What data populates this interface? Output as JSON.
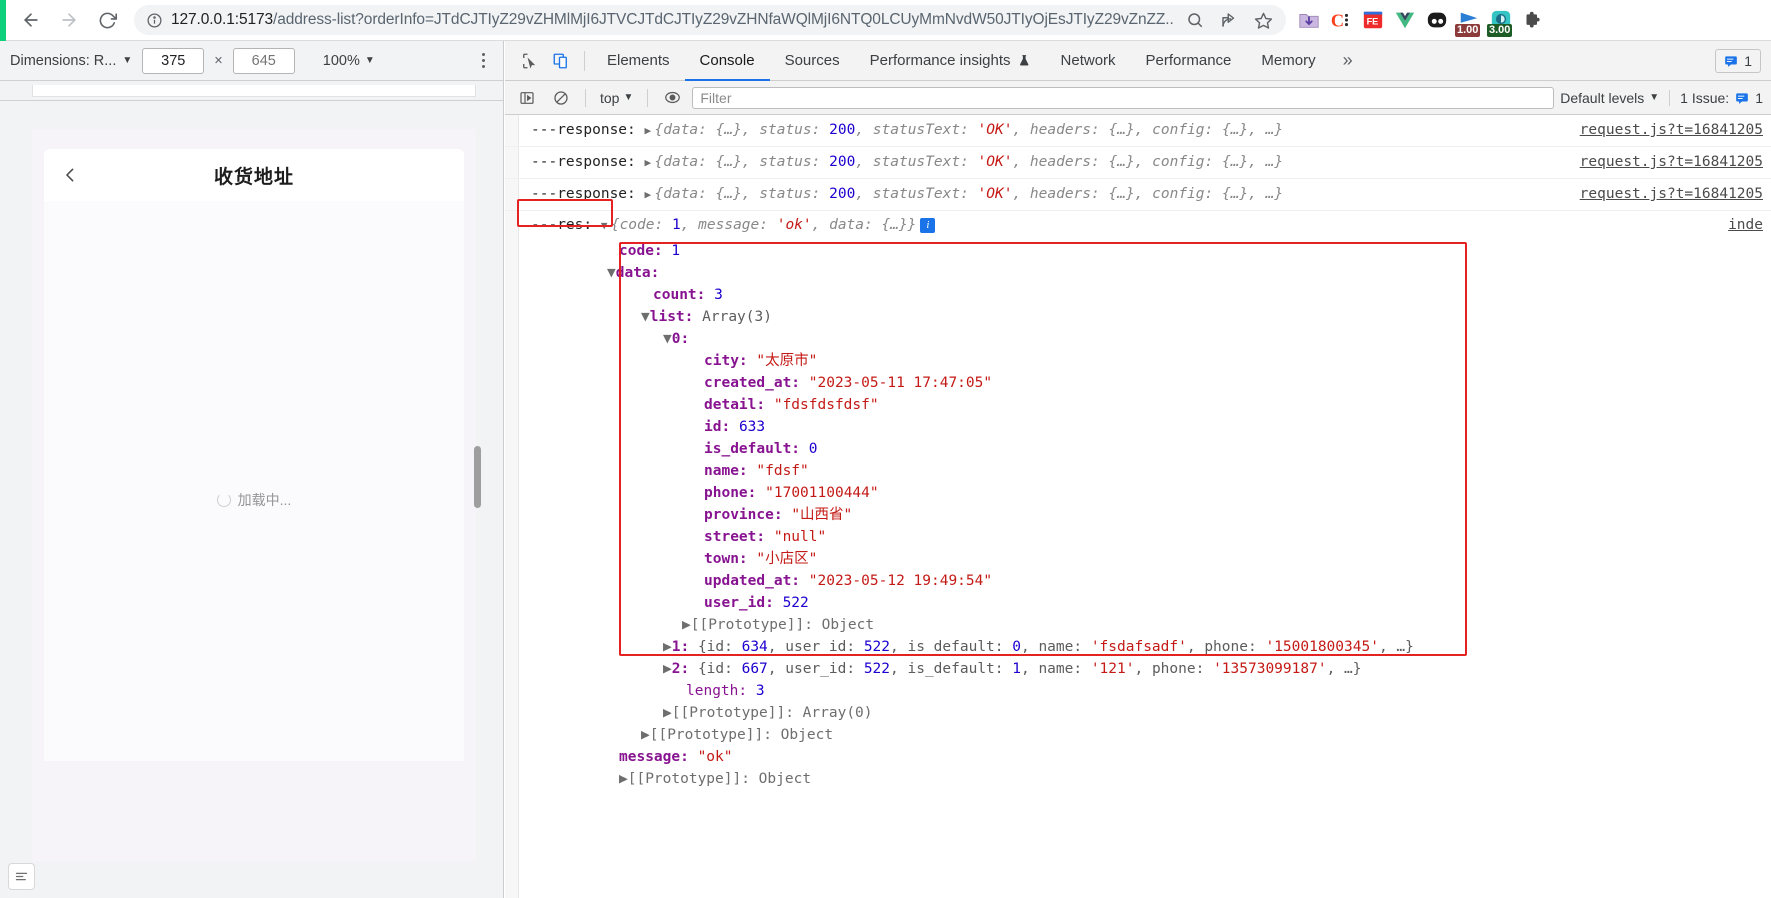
{
  "browser": {
    "back_icon": "arrow-left-icon",
    "forward_icon": "arrow-right-icon",
    "reload_icon": "reload-icon",
    "info_icon": "site-info-icon",
    "url_host": "127.0.0.1:5173",
    "url_path": "/address-list?orderInfo=",
    "url_query": "JTdCJTIyZ29vZHMlMjI6JTVCJTdCJTIyZ29vZHNfaWQlMjI6NTQ0LCUyMmNvdW50JTIyOjEsJTIyZ29vZnZZ...",
    "url_full": "127.0.0.1:5173/address-list?orderInfo=JTdCJTIyZ29vZHMlMjI6JTVCJTdCJTIyZ29vZHNfaWQlMjI6NTQ0LCUyMmNvdW50JTIyOjEsJTIyZ29vZvZ...",
    "zoom_icon": "zoom-out-icon",
    "share_icon": "share-icon",
    "bookmark_icon": "star-icon",
    "extensions": [
      {
        "name": "download-folder-extension-icon",
        "glyph": "folder",
        "badge": ""
      },
      {
        "name": "clickup-extension-icon",
        "glyph": "C",
        "badge": ""
      },
      {
        "name": "fe-helper-extension-icon",
        "glyph": "FE",
        "badge": ""
      },
      {
        "name": "vue-devtools-extension-icon",
        "glyph": "V",
        "badge": ""
      },
      {
        "name": "dark-reader-extension-icon",
        "glyph": "eyes",
        "badge": ""
      },
      {
        "name": "video-speed-controller-extension-icon",
        "glyph": "play",
        "badge": "1.00"
      },
      {
        "name": "video-speed-extension-icon",
        "glyph": "speed",
        "badge": "3.00"
      },
      {
        "name": "extensions-puzzle-icon",
        "glyph": "puzzle",
        "badge": ""
      }
    ]
  },
  "device_toolbar": {
    "dimensions_label": "Dimensions: R...",
    "dropdown_icon": "chevron-down-icon",
    "width_value": "375",
    "times": "×",
    "height_placeholder": "645",
    "zoom_value": "100%",
    "more_icon": "kebab-menu-icon"
  },
  "phone": {
    "back_icon": "chevron-left-icon",
    "title": "收货地址",
    "loading_text": "加载中...",
    "spinner_icon": "spinner-icon",
    "bottom_icon": "list-panel-icon"
  },
  "devtools": {
    "inspect_icon": "inspect-element-icon",
    "device_toggle_icon": "device-toolbar-icon",
    "tabs": [
      {
        "label": "Elements",
        "selected": false
      },
      {
        "label": "Console",
        "selected": true
      },
      {
        "label": "Sources",
        "selected": false
      },
      {
        "label": "Performance insights",
        "selected": false,
        "icon": "flask-icon"
      },
      {
        "label": "Network",
        "selected": false
      },
      {
        "label": "Performance",
        "selected": false
      },
      {
        "label": "Memory",
        "selected": false
      }
    ],
    "more_tabs_icon": "chevron-double-right-icon",
    "issue_count_label": "1",
    "issue_icon": "issue-message-icon",
    "filterbar": {
      "sidebar_toggle_icon": "console-sidebar-icon",
      "clear_icon": "clear-console-icon",
      "context_label": "top",
      "context_icon": "chevron-down-icon",
      "eye_icon": "live-expression-icon",
      "filter_placeholder": "Filter",
      "filter_value": "",
      "levels_label": "Default levels",
      "levels_icon": "chevron-down-icon",
      "issues_label": "1 Issue:",
      "issues_badge_icon": "issue-message-icon",
      "issues_count": "1"
    }
  },
  "console": {
    "response_rows": [
      {
        "label": "---response:",
        "arrow": "▶",
        "preview_parts": [
          {
            "t": "{data: ",
            "c": "grey"
          },
          {
            "t": "{…}",
            "c": "grey"
          },
          {
            "t": ", status: ",
            "c": "grey"
          },
          {
            "t": "200",
            "c": "num"
          },
          {
            "t": ", statusText: ",
            "c": "grey"
          },
          {
            "t": "'OK'",
            "c": "str"
          },
          {
            "t": ", headers: ",
            "c": "grey"
          },
          {
            "t": "{…}",
            "c": "grey"
          },
          {
            "t": ", config: ",
            "c": "grey"
          },
          {
            "t": "{…}",
            "c": "grey"
          },
          {
            "t": ", …}",
            "c": "grey"
          }
        ],
        "source": "request.js?t=16841205"
      },
      {
        "label": "---response:",
        "arrow": "▶",
        "source": "request.js?t=16841205"
      },
      {
        "label": "---response:",
        "arrow": "▶",
        "source": "request.js?t=16841205"
      }
    ],
    "res_row": {
      "label": "---res:",
      "arrow": "▼",
      "preview": "{code: 1, message: 'ok', data: {…}}",
      "info_badge": "i",
      "source": "inde"
    },
    "tree": {
      "code_key": "code:",
      "code_value": "1",
      "data_key": "data:",
      "count_key": "count:",
      "count_value": "3",
      "list_key": "list:",
      "list_value": "Array(3)",
      "item0_index": "0:",
      "item0": [
        {
          "key": "city:",
          "value": "\"太原市\"",
          "type": "str"
        },
        {
          "key": "created_at:",
          "value": "\"2023-05-11 17:47:05\"",
          "type": "str"
        },
        {
          "key": "detail:",
          "value": "\"fdsfdsfdsf\"",
          "type": "str"
        },
        {
          "key": "id:",
          "value": "633",
          "type": "num"
        },
        {
          "key": "is_default:",
          "value": "0",
          "type": "num"
        },
        {
          "key": "name:",
          "value": "\"fdsf\"",
          "type": "str"
        },
        {
          "key": "phone:",
          "value": "\"17001100444\"",
          "type": "str"
        },
        {
          "key": "province:",
          "value": "\"山西省\"",
          "type": "str"
        },
        {
          "key": "street:",
          "value": "\"null\"",
          "type": "str"
        },
        {
          "key": "town:",
          "value": "\"小店区\"",
          "type": "str"
        },
        {
          "key": "updated_at:",
          "value": "\"2023-05-12 19:49:54\"",
          "type": "str"
        },
        {
          "key": "user_id:",
          "value": "522",
          "type": "num"
        }
      ],
      "item0_proto": "[[Prototype]]: Object",
      "item1_index": "1:",
      "item1_parts": [
        {
          "t": "{id: ",
          "c": "grey"
        },
        {
          "t": "634",
          "c": "num"
        },
        {
          "t": ", user_id: ",
          "c": "grey"
        },
        {
          "t": "522",
          "c": "num"
        },
        {
          "t": ", is_default: ",
          "c": "grey"
        },
        {
          "t": "0",
          "c": "num"
        },
        {
          "t": ", name: ",
          "c": "grey"
        },
        {
          "t": "'fsdafsadf'",
          "c": "str"
        },
        {
          "t": ", phone: ",
          "c": "grey"
        },
        {
          "t": "'15001800345'",
          "c": "str"
        },
        {
          "t": ", …}",
          "c": "grey"
        }
      ],
      "item2_index": "2:",
      "item2_parts": [
        {
          "t": "{id: ",
          "c": "grey"
        },
        {
          "t": "667",
          "c": "num"
        },
        {
          "t": ", user_id: ",
          "c": "grey"
        },
        {
          "t": "522",
          "c": "num"
        },
        {
          "t": ", is_default: ",
          "c": "grey"
        },
        {
          "t": "1",
          "c": "num"
        },
        {
          "t": ", name: ",
          "c": "grey"
        },
        {
          "t": "'121'",
          "c": "str"
        },
        {
          "t": ", phone: ",
          "c": "grey"
        },
        {
          "t": "'13573099187'",
          "c": "str"
        },
        {
          "t": ", …}",
          "c": "grey"
        }
      ],
      "length_key": "length:",
      "length_value": "3",
      "array_proto": "[[Prototype]]: Array(0)",
      "data_proto": "[[Prototype]]: Object",
      "message_key": "message:",
      "message_value": "\"ok\"",
      "root_proto": "[[Prototype]]: Object"
    }
  },
  "colors": {
    "accent": "#1a73e8",
    "highlight_red": "#e42222",
    "string_red": "#c41a16",
    "number_blue": "#1c00cf",
    "key_purple": "#881391",
    "green_edge": "#0fd07a"
  }
}
